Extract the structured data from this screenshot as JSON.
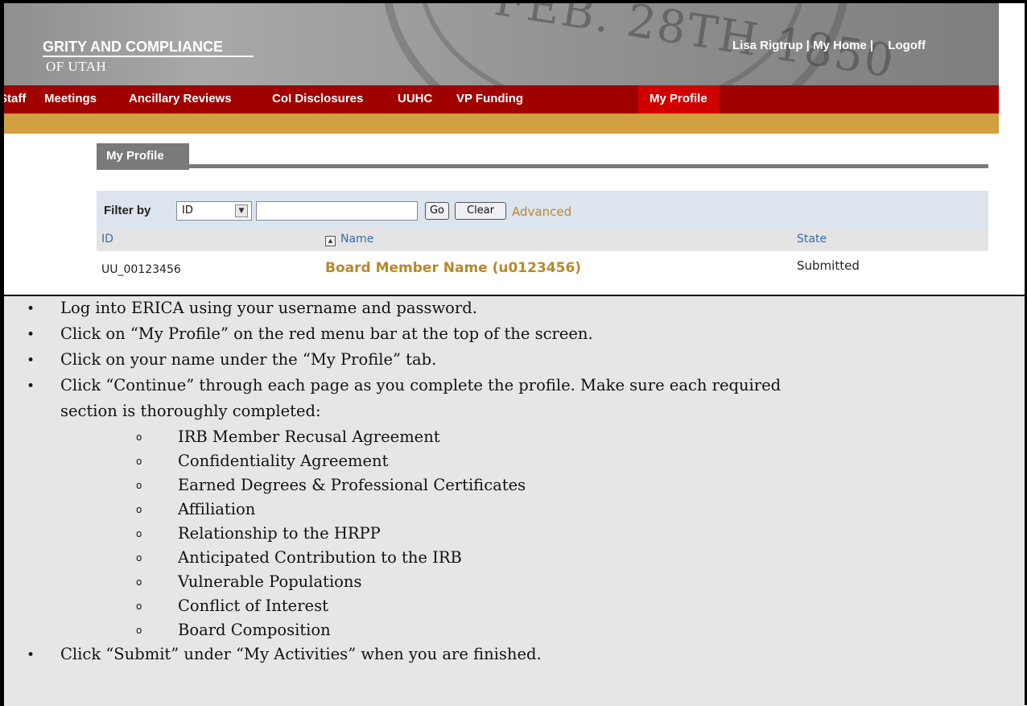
{
  "banner": {
    "org_title": "GRITY AND COMPLIANCE",
    "org_subtitle": "OF UTAH",
    "seal_text": "FEB. 28TH 1850",
    "user_name": "Lisa Rigtrup",
    "sep1": " | ",
    "my_home": "My Home",
    "sep2": " | ",
    "logoff": "Logoff"
  },
  "nav": {
    "items": [
      {
        "label": "Staff"
      },
      {
        "label": "Meetings"
      },
      {
        "label": "Ancillary Reviews"
      },
      {
        "label": "CoI Disclosures"
      },
      {
        "label": "UUHC"
      },
      {
        "label": "VP Funding"
      },
      {
        "label": "My Profile"
      }
    ],
    "active": "My Profile",
    "colors": {
      "bar": "#a10000",
      "active": "#d00000",
      "gold": "#d1a040"
    }
  },
  "tab": {
    "label": "My Profile"
  },
  "filter": {
    "label": "Filter by",
    "selected": "ID",
    "input_value": "",
    "go_label": "Go",
    "clear_label": "Clear",
    "advanced_label": "Advanced"
  },
  "table": {
    "columns": [
      "ID",
      "Name",
      "State"
    ],
    "rows": [
      {
        "id": "UU_00123456",
        "name": "Board Member Name (u0123456)",
        "state": "Submitted"
      }
    ]
  },
  "instructions": {
    "steps": [
      "Log into ERICA using your username and password.",
      "Click on “My Profile” on the red menu bar at the top of the screen.",
      "Click on your name under the “My Profile” tab.",
      "Click “Continue” through each page as you complete the profile.  Make sure each required",
      "section is thoroughly completed:"
    ],
    "sections": [
      "IRB Member Recusal Agreement",
      "Confidentiality Agreement",
      "Earned Degrees & Professional Certificates",
      "Affiliation",
      "Relationship to the HRPP",
      "Anticipated Contribution to the IRB",
      "Vulnerable Populations",
      "Conflict of Interest",
      "Board Composition"
    ],
    "final_step": "Click “Submit” under “My Activities” when you are finished."
  }
}
